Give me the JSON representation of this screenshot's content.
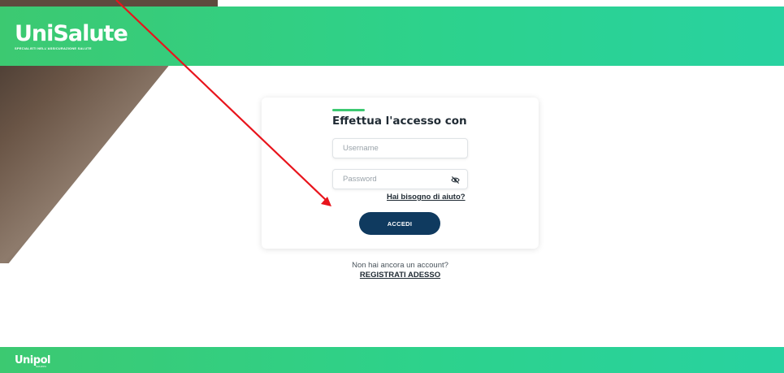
{
  "header": {
    "logo_text": "UniSalute",
    "logo_tagline": "SPECIALISTI NELL'ASSICURAZIONE SALUTE"
  },
  "login": {
    "title": "Effettua l'accesso con",
    "username_placeholder": "Username",
    "password_placeholder": "Password",
    "help_link": "Hai bisogno di aiuto?",
    "submit_label": "ACCEDI"
  },
  "signup": {
    "prompt": "Non hai ancora un account?",
    "link": "REGISTRATI ADESSO"
  },
  "footer": {
    "logo_text": "Unipol",
    "logo_sub": "GRUPPO"
  },
  "colors": {
    "brand_green": "#2dd28c",
    "button_navy": "#0f3a5f",
    "annotation_arrow": "#e8141c"
  },
  "icons": {
    "password_toggle": "eye-off-icon"
  }
}
